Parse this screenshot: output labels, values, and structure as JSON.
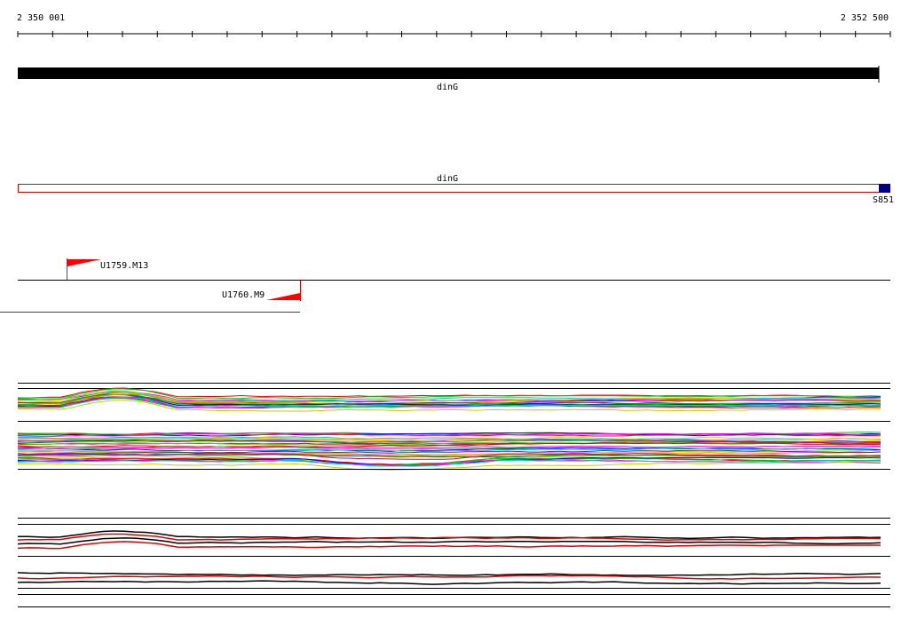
{
  "ruler": {
    "start_label": "2 350 001",
    "end_label": "2 352 500"
  },
  "gene_track": {
    "label": "dinG",
    "color": "#000000"
  },
  "transcript_track": {
    "label": "dinG",
    "outline_color": "#e00000",
    "end_feature_label": "S851",
    "end_feature_color": "#00008b"
  },
  "oligo_track": {
    "forward": "U1759.M13",
    "reverse": "U1760.M9",
    "color": "#ff0000"
  },
  "signal_tracks": {
    "colors": [
      "#ff0000",
      "#00cc00",
      "#0000ff",
      "#ff00ff",
      "#00cccc",
      "#cccc00",
      "#ff8800",
      "#8800ff",
      "#888888",
      "#008800",
      "#cc0066",
      "#66cc00"
    ],
    "summary_colors": [
      "#000000",
      "#e00000"
    ]
  }
}
